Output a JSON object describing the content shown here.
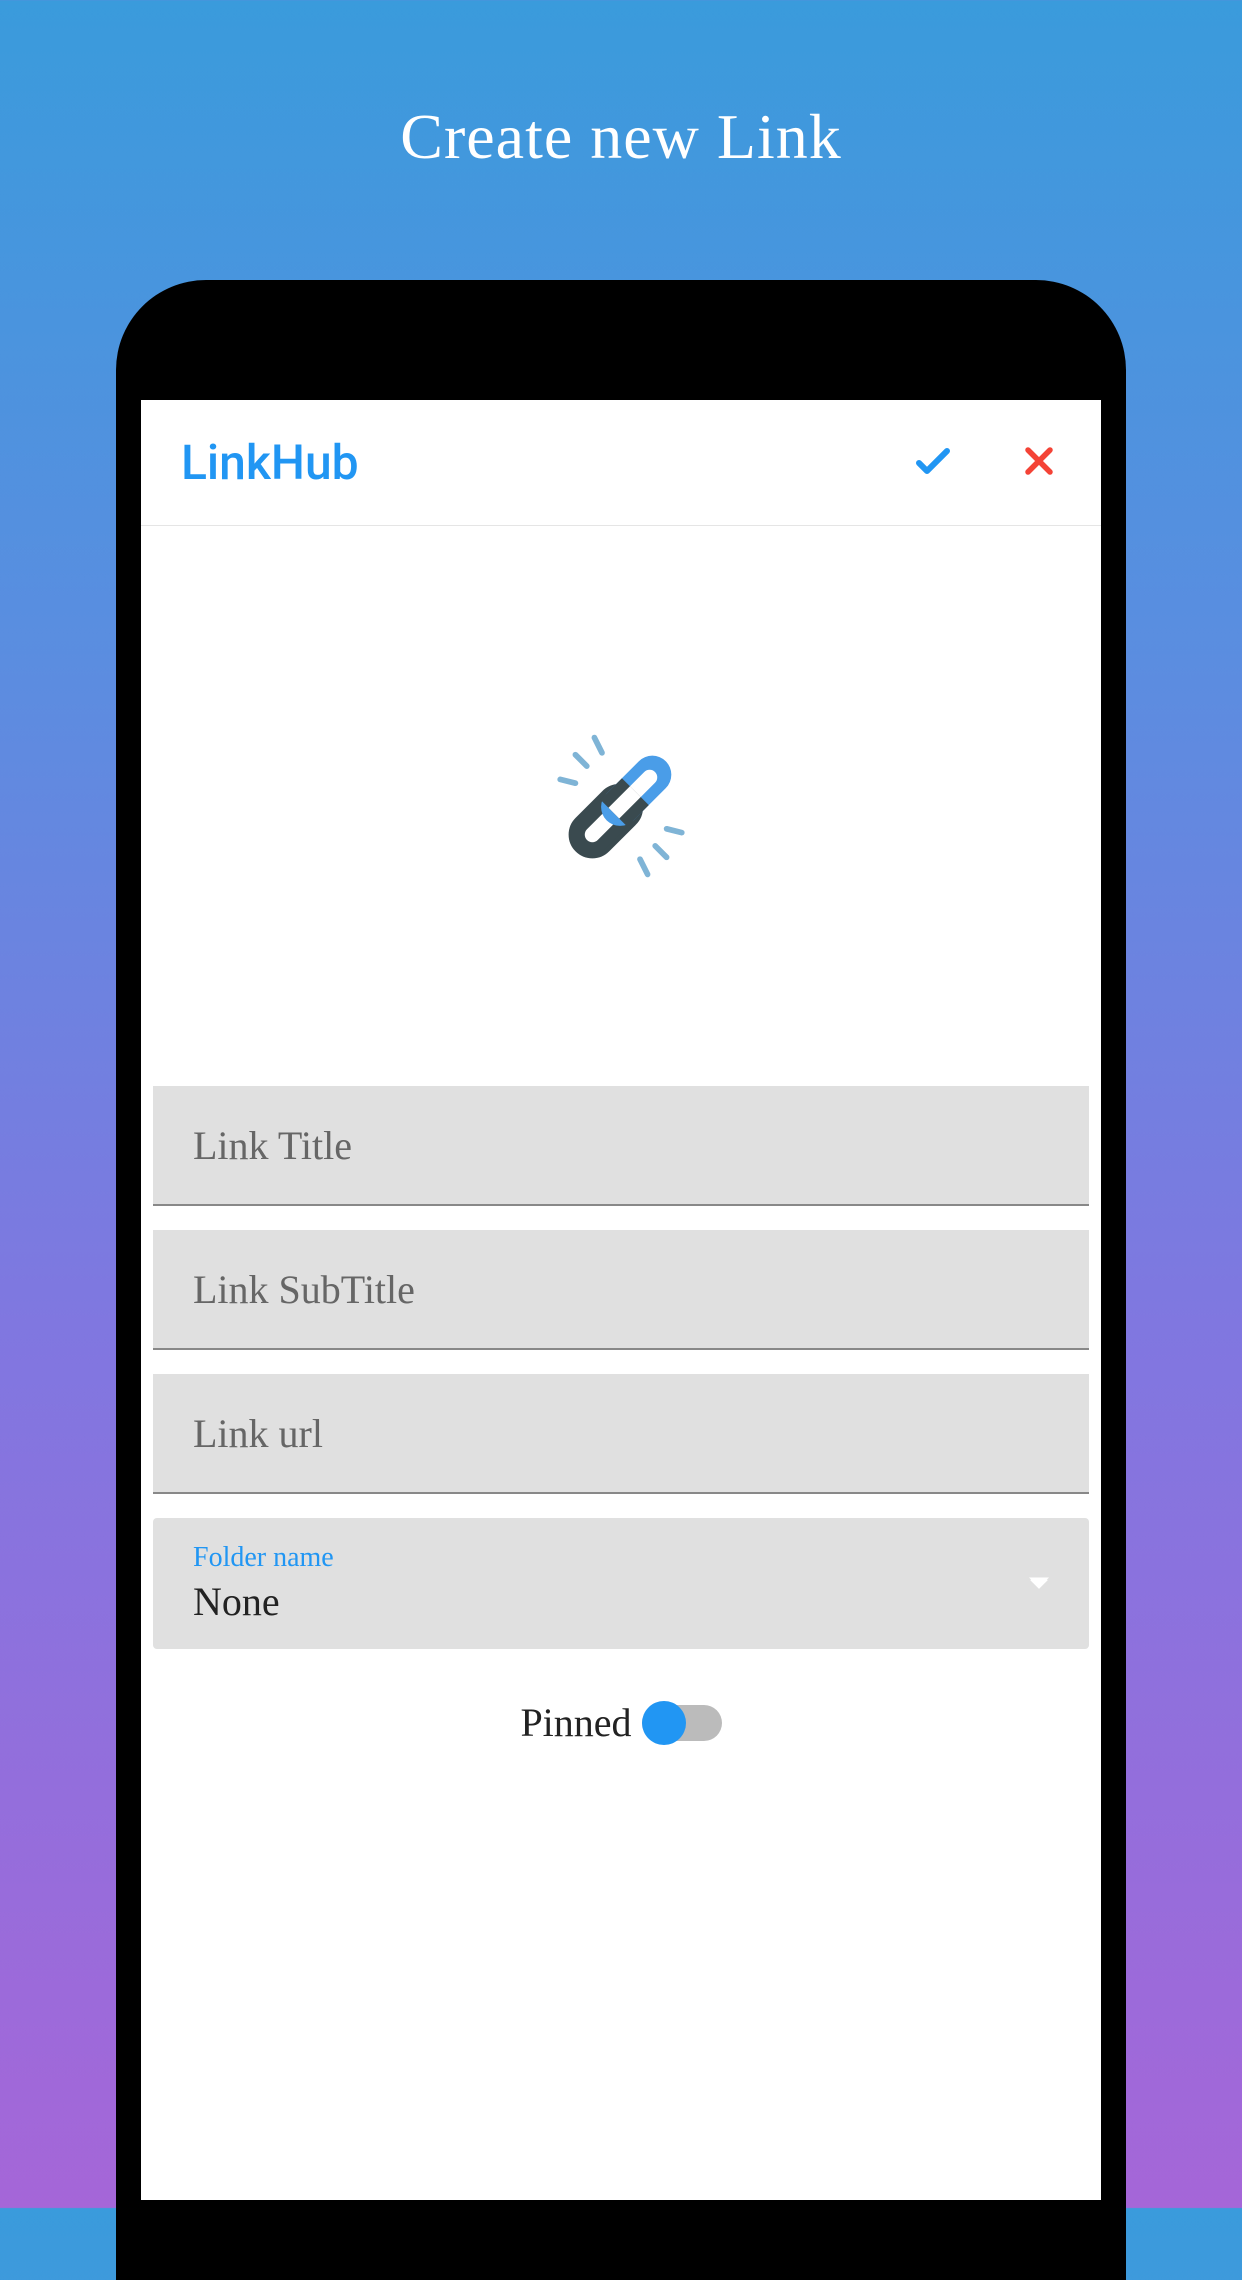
{
  "page": {
    "title": "Create new Link"
  },
  "header": {
    "app_name": "LinkHub"
  },
  "form": {
    "title_placeholder": "Link Title",
    "subtitle_placeholder": "Link SubTitle",
    "url_placeholder": "Link url",
    "folder_label": "Folder name",
    "folder_value": "None",
    "pinned_label": "Pinned",
    "pinned_state": false
  }
}
